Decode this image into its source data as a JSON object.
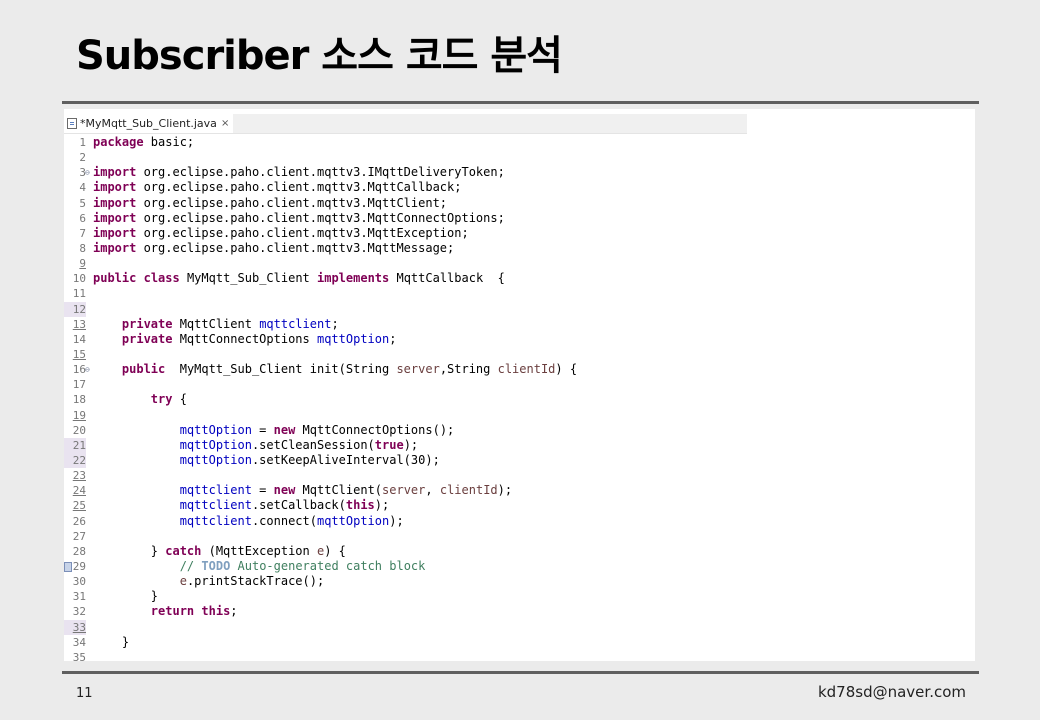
{
  "slide": {
    "title": "Subscriber 소스 코드 분석",
    "page_number": "11",
    "author_email": "kd78sd@naver.com"
  },
  "editor": {
    "tab_label": "*MyMqtt_Sub_Client.java",
    "tab_close_glyph": "×",
    "file_icon": "java-file-icon",
    "colors": {
      "keyword": "#7f0055",
      "field": "#0000c0",
      "parameter": "#6a3e3e",
      "comment": "#3f7f5f",
      "todo": "#7f9fbf"
    },
    "lines": [
      {
        "num": "1",
        "segments": [
          {
            "t": "package",
            "c": "kw"
          },
          {
            "t": " basic;"
          }
        ]
      },
      {
        "num": "2",
        "segments": []
      },
      {
        "num": "3",
        "fold": "⊖",
        "segments": [
          {
            "t": "import",
            "c": "kw"
          },
          {
            "t": " org.eclipse.paho.client.mqttv3.IMqttDeliveryToken;"
          }
        ]
      },
      {
        "num": "4",
        "segments": [
          {
            "t": "import",
            "c": "kw"
          },
          {
            "t": " org.eclipse.paho.client.mqttv3.MqttCallback;"
          }
        ]
      },
      {
        "num": "5",
        "segments": [
          {
            "t": "import",
            "c": "kw"
          },
          {
            "t": " org.eclipse.paho.client.mqttv3.MqttClient;"
          }
        ]
      },
      {
        "num": "6",
        "segments": [
          {
            "t": "import",
            "c": "kw"
          },
          {
            "t": " org.eclipse.paho.client.mqttv3.MqttConnectOptions;"
          }
        ]
      },
      {
        "num": "7",
        "segments": [
          {
            "t": "import",
            "c": "kw"
          },
          {
            "t": " org.eclipse.paho.client.mqttv3.MqttException;"
          }
        ]
      },
      {
        "num": "8",
        "segments": [
          {
            "t": "import",
            "c": "kw"
          },
          {
            "t": " org.eclipse.paho.client.mqttv3.MqttMessage;"
          }
        ]
      },
      {
        "num": "9",
        "u": true,
        "segments": []
      },
      {
        "num": "10",
        "segments": [
          {
            "t": "public",
            "c": "kw"
          },
          {
            "t": " "
          },
          {
            "t": "class",
            "c": "kw"
          },
          {
            "t": " MyMqtt_Sub_Client "
          },
          {
            "t": "implements",
            "c": "kw"
          },
          {
            "t": " MqttCallback  {"
          }
        ]
      },
      {
        "num": "11",
        "segments": []
      },
      {
        "num": "12",
        "hl": true,
        "segments": []
      },
      {
        "num": "13",
        "u": true,
        "segments": [
          {
            "t": "    "
          },
          {
            "t": "private",
            "c": "kw"
          },
          {
            "t": " MqttClient "
          },
          {
            "t": "mqttclient",
            "c": "fld"
          },
          {
            "t": ";"
          }
        ]
      },
      {
        "num": "14",
        "segments": [
          {
            "t": "    "
          },
          {
            "t": "private",
            "c": "kw"
          },
          {
            "t": " MqttConnectOptions "
          },
          {
            "t": "mqttOption",
            "c": "fld"
          },
          {
            "t": ";"
          }
        ]
      },
      {
        "num": "15",
        "u": true,
        "segments": []
      },
      {
        "num": "16",
        "fold": "⊖",
        "segments": [
          {
            "t": "    "
          },
          {
            "t": "public",
            "c": "kw"
          },
          {
            "t": "  MyMqtt_Sub_Client init(String "
          },
          {
            "t": "server",
            "c": "prm"
          },
          {
            "t": ",String "
          },
          {
            "t": "clientId",
            "c": "prm"
          },
          {
            "t": ") {"
          }
        ]
      },
      {
        "num": "17",
        "segments": []
      },
      {
        "num": "18",
        "segments": [
          {
            "t": "        "
          },
          {
            "t": "try",
            "c": "kw"
          },
          {
            "t": " {"
          }
        ]
      },
      {
        "num": "19",
        "u": true,
        "segments": []
      },
      {
        "num": "20",
        "segments": [
          {
            "t": "            "
          },
          {
            "t": "mqttOption",
            "c": "fld"
          },
          {
            "t": " = "
          },
          {
            "t": "new",
            "c": "kw"
          },
          {
            "t": " MqttConnectOptions();"
          }
        ]
      },
      {
        "num": "21",
        "hl": true,
        "segments": [
          {
            "t": "            "
          },
          {
            "t": "mqttOption",
            "c": "fld"
          },
          {
            "t": ".setCleanSession("
          },
          {
            "t": "true",
            "c": "kw"
          },
          {
            "t": ");"
          }
        ]
      },
      {
        "num": "22",
        "hl": true,
        "segments": [
          {
            "t": "            "
          },
          {
            "t": "mqttOption",
            "c": "fld"
          },
          {
            "t": ".setKeepAliveInterval(30);"
          }
        ]
      },
      {
        "num": "23",
        "u": true,
        "segments": []
      },
      {
        "num": "24",
        "u": true,
        "segments": [
          {
            "t": "            "
          },
          {
            "t": "mqttclient",
            "c": "fld"
          },
          {
            "t": " = "
          },
          {
            "t": "new",
            "c": "kw"
          },
          {
            "t": " MqttClient("
          },
          {
            "t": "server",
            "c": "prm"
          },
          {
            "t": ", "
          },
          {
            "t": "clientId",
            "c": "prm"
          },
          {
            "t": ");"
          }
        ]
      },
      {
        "num": "25",
        "u": true,
        "segments": [
          {
            "t": "            "
          },
          {
            "t": "mqttclient",
            "c": "fld"
          },
          {
            "t": ".setCallback("
          },
          {
            "t": "this",
            "c": "kw"
          },
          {
            "t": ");"
          }
        ]
      },
      {
        "num": "26",
        "segments": [
          {
            "t": "            "
          },
          {
            "t": "mqttclient",
            "c": "fld"
          },
          {
            "t": ".connect("
          },
          {
            "t": "mqttOption",
            "c": "fld"
          },
          {
            "t": ");"
          }
        ]
      },
      {
        "num": "27",
        "segments": []
      },
      {
        "num": "28",
        "segments": [
          {
            "t": "        } "
          },
          {
            "t": "catch",
            "c": "kw"
          },
          {
            "t": " (MqttException "
          },
          {
            "t": "e",
            "c": "prm"
          },
          {
            "t": ") {"
          }
        ]
      },
      {
        "num": "29",
        "task": true,
        "segments": [
          {
            "t": "            "
          },
          {
            "t": "// ",
            "c": "cm"
          },
          {
            "t": "TODO",
            "c": "todo"
          },
          {
            "t": " Auto-generated catch block",
            "c": "cm"
          }
        ]
      },
      {
        "num": "30",
        "segments": [
          {
            "t": "            "
          },
          {
            "t": "e",
            "c": "prm"
          },
          {
            "t": ".printStackTrace();"
          }
        ]
      },
      {
        "num": "31",
        "segments": [
          {
            "t": "        }"
          }
        ]
      },
      {
        "num": "32",
        "segments": [
          {
            "t": "        "
          },
          {
            "t": "return",
            "c": "kw"
          },
          {
            "t": " "
          },
          {
            "t": "this",
            "c": "kw"
          },
          {
            "t": ";"
          }
        ]
      },
      {
        "num": "33",
        "u": true,
        "hl": true,
        "segments": []
      },
      {
        "num": "34",
        "segments": [
          {
            "t": "    }"
          }
        ]
      },
      {
        "num": "35",
        "segments": []
      }
    ]
  }
}
